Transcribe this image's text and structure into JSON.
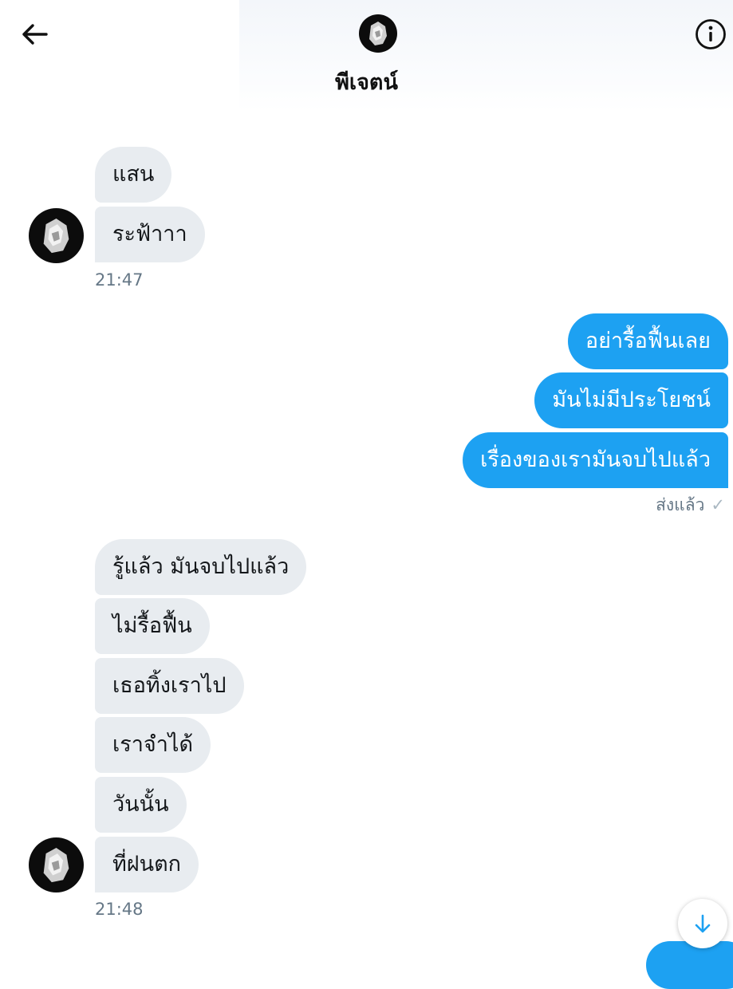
{
  "header": {
    "title": "พีเจตน์",
    "back_icon": "arrow-left-icon",
    "info_icon": "info-circle-icon",
    "avatar": "contact-avatar"
  },
  "colors": {
    "accent": "#1da1f2",
    "incoming_bubble": "#e8ecf0",
    "timestamp_text": "#657786"
  },
  "conversation": {
    "group1": {
      "messages": [
        "แสน",
        "ระฟ้าาา"
      ],
      "time": "21:47"
    },
    "group2": {
      "messages": [
        "อย่ารื้อฟื้นเลย",
        "มันไม่มีประโยชน์",
        "เรื่องของเรามันจบไปแล้ว"
      ],
      "status": "ส่งแล้ว"
    },
    "group3": {
      "messages": [
        "รู้แล้ว มันจบไปแล้ว",
        "ไม่รื้อฟื้น",
        "เธอทิ้งเราไป",
        "เราจำได้",
        "วันนั้น",
        "ที่ฝนตก"
      ],
      "time": "21:48"
    }
  },
  "scroll_button_icon": "arrow-down-icon"
}
